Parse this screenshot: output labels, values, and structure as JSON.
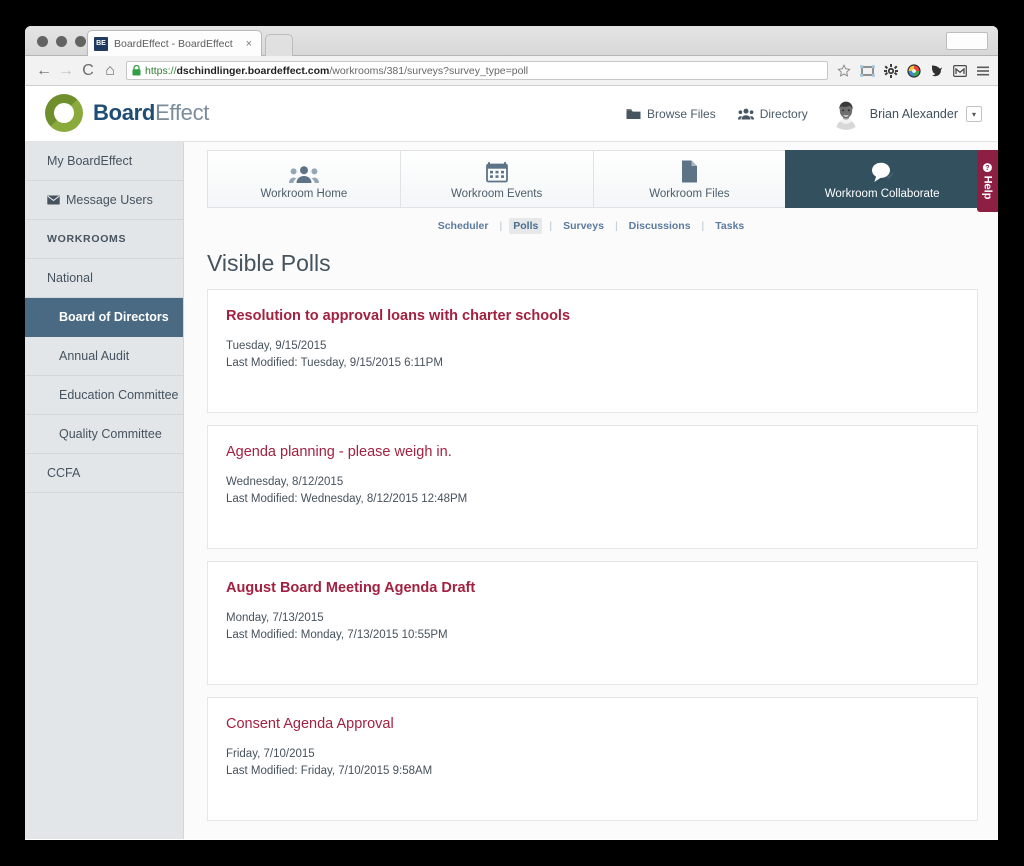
{
  "browser": {
    "tab_title": "BoardEffect - BoardEffect",
    "favicon_text": "BE",
    "close_glyph": "×",
    "back_glyph": "←",
    "forward_glyph": "→",
    "reload_glyph": "C",
    "home_glyph": "⌂",
    "url_scheme": "https://",
    "url_domain": "dschindlinger.boardeffect.com",
    "url_path": "/workrooms/381/surveys?survey_type=poll",
    "toolbar_icons": [
      "star-icon",
      "screenshot-frame-icon",
      "gear-icon",
      "color-wheel-icon",
      "pocket-bird-icon",
      "gmail-icon",
      "hamburger-menu-icon"
    ]
  },
  "header": {
    "logo_bold": "Board",
    "logo_light": "Effect",
    "nav": [
      {
        "label": "Browse Files",
        "icon": "folder-icon"
      },
      {
        "label": "Directory",
        "icon": "people-group-icon"
      }
    ],
    "user_name": "Brian Alexander",
    "caret_glyph": "▾"
  },
  "sidebar": {
    "items": [
      {
        "label": "My BoardEffect",
        "type": "link",
        "icon": null
      },
      {
        "label": "Message Users",
        "type": "link",
        "icon": "envelope-icon"
      },
      {
        "label": "WORKROOMS",
        "type": "section",
        "icon": null
      },
      {
        "label": "National",
        "type": "link",
        "icon": null
      },
      {
        "label": "Board of Directors",
        "type": "link-active",
        "icon": null
      },
      {
        "label": "Annual Audit",
        "type": "link-indent",
        "icon": null
      },
      {
        "label": "Education Committee",
        "type": "link-indent",
        "icon": null
      },
      {
        "label": "Quality Committee",
        "type": "link-indent",
        "icon": null
      },
      {
        "label": "CCFA",
        "type": "link",
        "icon": null
      }
    ]
  },
  "section_tabs": [
    {
      "label": "Workroom Home",
      "icon": "people-group-icon",
      "active": false
    },
    {
      "label": "Workroom Events",
      "icon": "calendar-icon",
      "active": false
    },
    {
      "label": "Workroom Files",
      "icon": "document-icon",
      "active": false
    },
    {
      "label": "Workroom Collaborate",
      "icon": "speech-bubble-icon",
      "active": true
    }
  ],
  "sub_nav": {
    "items": [
      "Scheduler",
      "Polls",
      "Surveys",
      "Discussions",
      "Tasks"
    ],
    "active": "Polls",
    "separator": "|"
  },
  "main": {
    "page_title": "Visible Polls",
    "polls": [
      {
        "title": "Resolution to approval loans with charter schools",
        "bold": true,
        "date": "Tuesday, 9/15/2015",
        "last_modified": "Last Modified: Tuesday, 9/15/2015 6:11PM"
      },
      {
        "title": "Agenda planning - please weigh in.",
        "bold": false,
        "date": "Wednesday, 8/12/2015",
        "last_modified": "Last Modified: Wednesday, 8/12/2015 12:48PM"
      },
      {
        "title": "August Board Meeting Agenda Draft",
        "bold": true,
        "date": "Monday, 7/13/2015",
        "last_modified": "Last Modified: Monday, 7/13/2015 10:55PM"
      },
      {
        "title": "Consent Agenda Approval",
        "bold": false,
        "date": "Friday, 7/10/2015",
        "last_modified": "Last Modified: Friday, 7/10/2015 9:58AM"
      }
    ]
  },
  "help_tab": {
    "label": "Help",
    "icon": "question-circle-icon"
  },
  "colors": {
    "brand_blue": "#1f4d73",
    "logo_green": "#8aab3c",
    "active_tab": "#33505f",
    "sidebar_active": "#4a6a83",
    "poll_title": "#a32140",
    "help_maroon": "#8c1f42",
    "sidebar_bg": "#e2e6e9"
  }
}
